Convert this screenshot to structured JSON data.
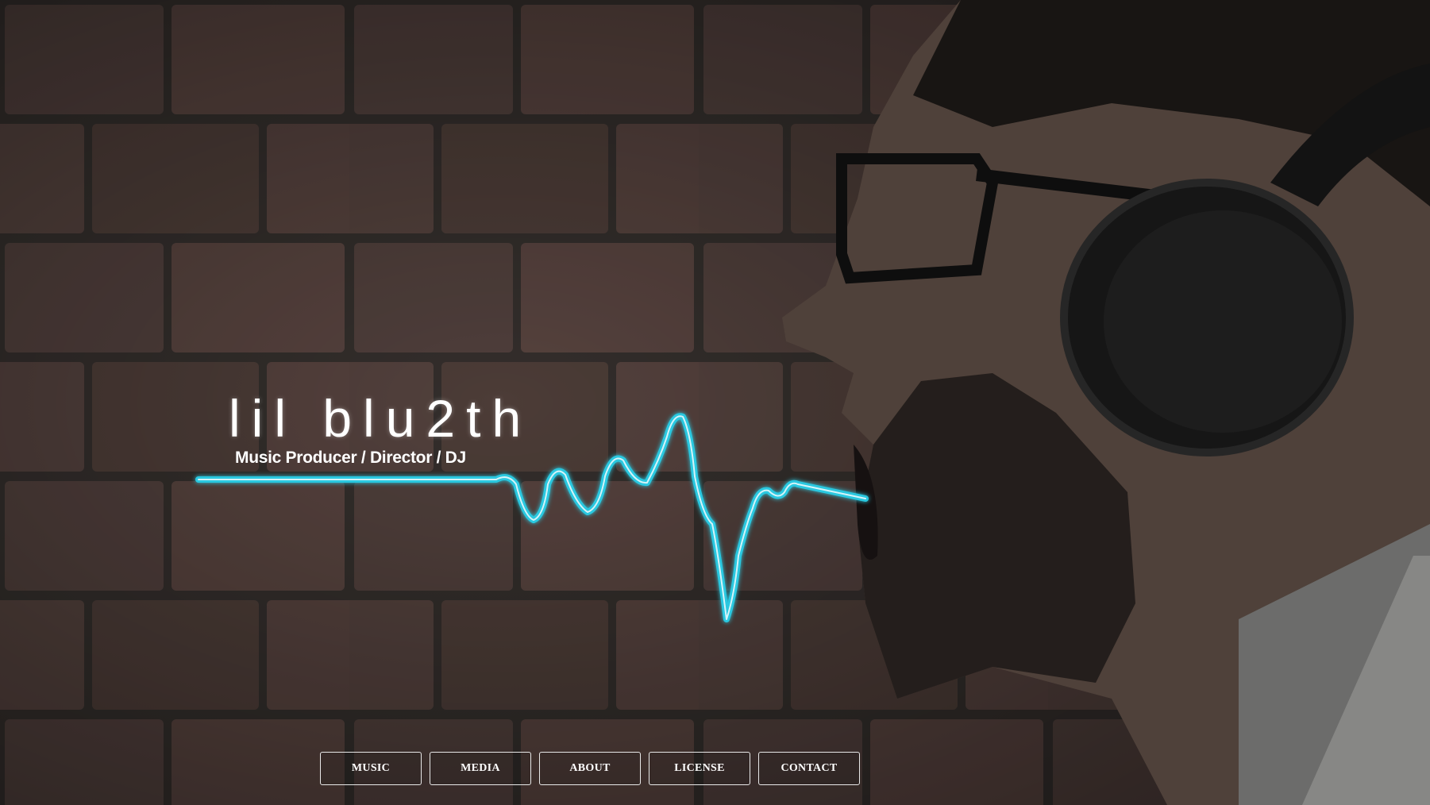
{
  "brand": {
    "title": "lil blu2th",
    "subtitle": "Music Producer / Director / DJ"
  },
  "nav": {
    "items": [
      {
        "label": "MUSIC"
      },
      {
        "label": "MEDIA"
      },
      {
        "label": "ABOUT"
      },
      {
        "label": "LICENSE"
      },
      {
        "label": "CONTACT"
      }
    ]
  },
  "colors": {
    "waveform": "#29c8e0",
    "waveform_core": "#ffffff",
    "text": "#ffffff",
    "button_border": "#e8e8e8"
  },
  "icons": {
    "background": "brick-wall-photo",
    "headphones": "headphones-icon"
  }
}
